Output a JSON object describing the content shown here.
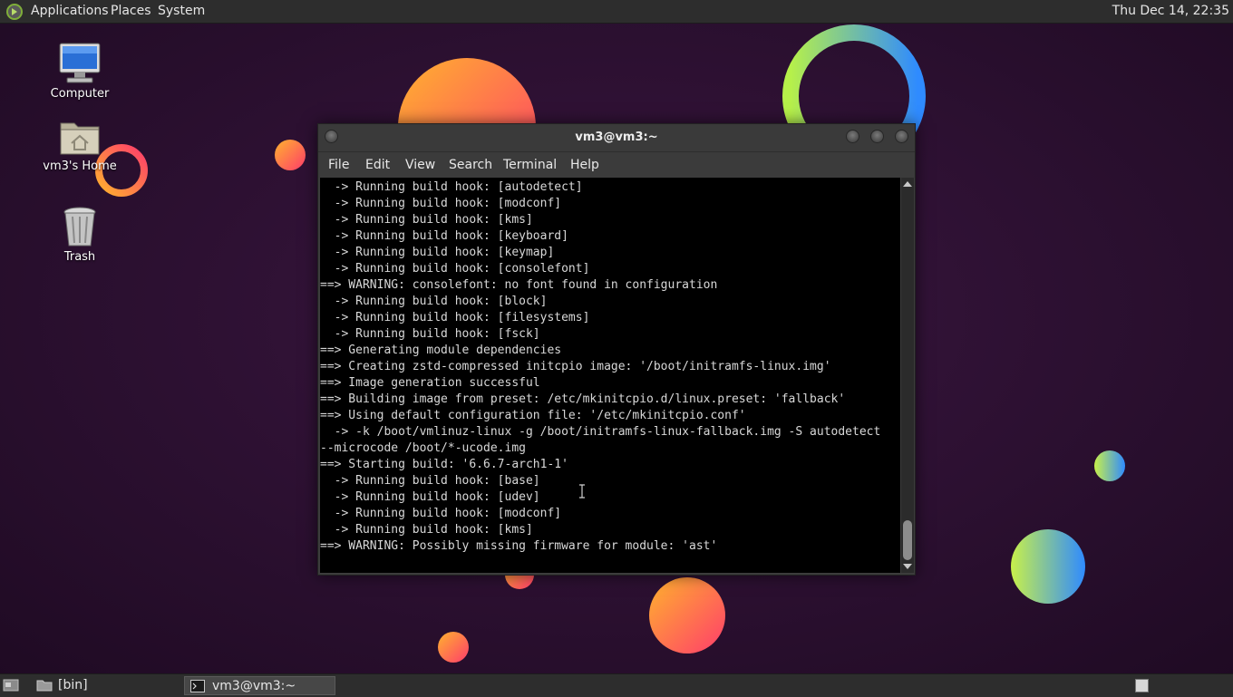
{
  "top_panel": {
    "menus": [
      "Applications",
      "Places",
      "System"
    ],
    "clock": "Thu Dec 14, 22:35"
  },
  "desktop": {
    "icons": [
      {
        "label": "Computer",
        "icon": "computer-icon"
      },
      {
        "label": "vm3's Home",
        "icon": "home-folder-icon"
      },
      {
        "label": "Trash",
        "icon": "trash-icon"
      }
    ],
    "wallpaper_colors": [
      "#2a0f2e",
      "#ff5a4f",
      "#ffb22e",
      "#2f8bff",
      "#b6f04a"
    ]
  },
  "terminal": {
    "title": "vm3@vm3:~",
    "menus": [
      "File",
      "Edit",
      "View",
      "Search",
      "Terminal",
      "Help"
    ],
    "lines": [
      "  -> Running build hook: [autodetect]",
      "  -> Running build hook: [modconf]",
      "  -> Running build hook: [kms]",
      "  -> Running build hook: [keyboard]",
      "  -> Running build hook: [keymap]",
      "  -> Running build hook: [consolefont]",
      "==> WARNING: consolefont: no font found in configuration",
      "  -> Running build hook: [block]",
      "  -> Running build hook: [filesystems]",
      "  -> Running build hook: [fsck]",
      "==> Generating module dependencies",
      "==> Creating zstd-compressed initcpio image: '/boot/initramfs-linux.img'",
      "==> Image generation successful",
      "==> Building image from preset: /etc/mkinitcpio.d/linux.preset: 'fallback'",
      "==> Using default configuration file: '/etc/mkinitcpio.conf'",
      "  -> -k /boot/vmlinuz-linux -g /boot/initramfs-linux-fallback.img -S autodetect",
      "--microcode /boot/*-ucode.img",
      "==> Starting build: '6.6.7-arch1-1'",
      "  -> Running build hook: [base]",
      "  -> Running build hook: [udev]",
      "  -> Running build hook: [modconf]",
      "  -> Running build hook: [kms]",
      "==> WARNING: Possibly missing firmware for module: 'ast'"
    ]
  },
  "taskbar": {
    "tasks": [
      {
        "label": "[bin]",
        "icon": "folder-icon",
        "active": false
      },
      {
        "label": "vm3@vm3:~",
        "icon": "terminal-icon",
        "active": true
      }
    ]
  }
}
